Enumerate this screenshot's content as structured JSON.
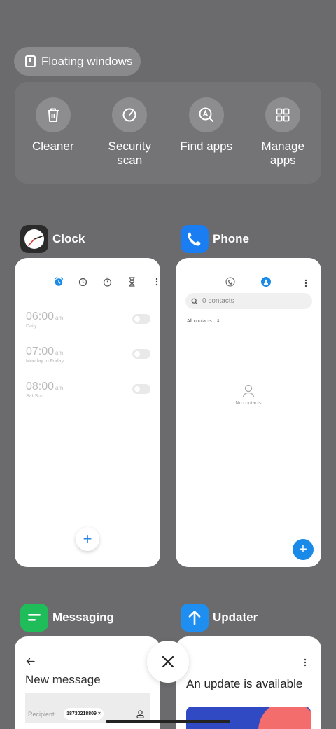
{
  "floating_windows": {
    "label": "Floating windows",
    "icon": "floating-window-icon"
  },
  "tools": [
    {
      "label": "Cleaner",
      "icon": "trash-icon"
    },
    {
      "label": "Security\nscan",
      "icon": "security-scan-icon"
    },
    {
      "label": "Find apps",
      "icon": "find-apps-icon"
    },
    {
      "label": "Manage\napps",
      "icon": "grid-icon"
    }
  ],
  "apps": {
    "clock": {
      "name": "Clock",
      "alarms": [
        {
          "time": "06:00",
          "ampm": "am",
          "repeat": "Daily",
          "enabled": false
        },
        {
          "time": "07:00",
          "ampm": "am",
          "repeat": "Monday to Friday",
          "enabled": false
        },
        {
          "time": "08:00",
          "ampm": "am",
          "repeat": "Sat Sun",
          "enabled": false
        }
      ],
      "add_label": "+"
    },
    "phone": {
      "name": "Phone",
      "search_placeholder": "0 contacts",
      "filter_label": "All contacts",
      "empty_text": "No contacts",
      "add_label": "+"
    },
    "messaging": {
      "name": "Messaging",
      "title": "New message",
      "recipient_label": "Recipient:",
      "recipient_chip": "18730218809 ×"
    },
    "updater": {
      "name": "Updater",
      "title": "An update is available"
    }
  },
  "colors": {
    "background": "#6b6b6e",
    "accent_blue": "#1a8ae8",
    "clock_icon": "#2b2b2b",
    "phone_icon": "#1a7ef2",
    "messaging_icon": "#1fbd5a",
    "updater_icon": "#1e8ff0"
  }
}
